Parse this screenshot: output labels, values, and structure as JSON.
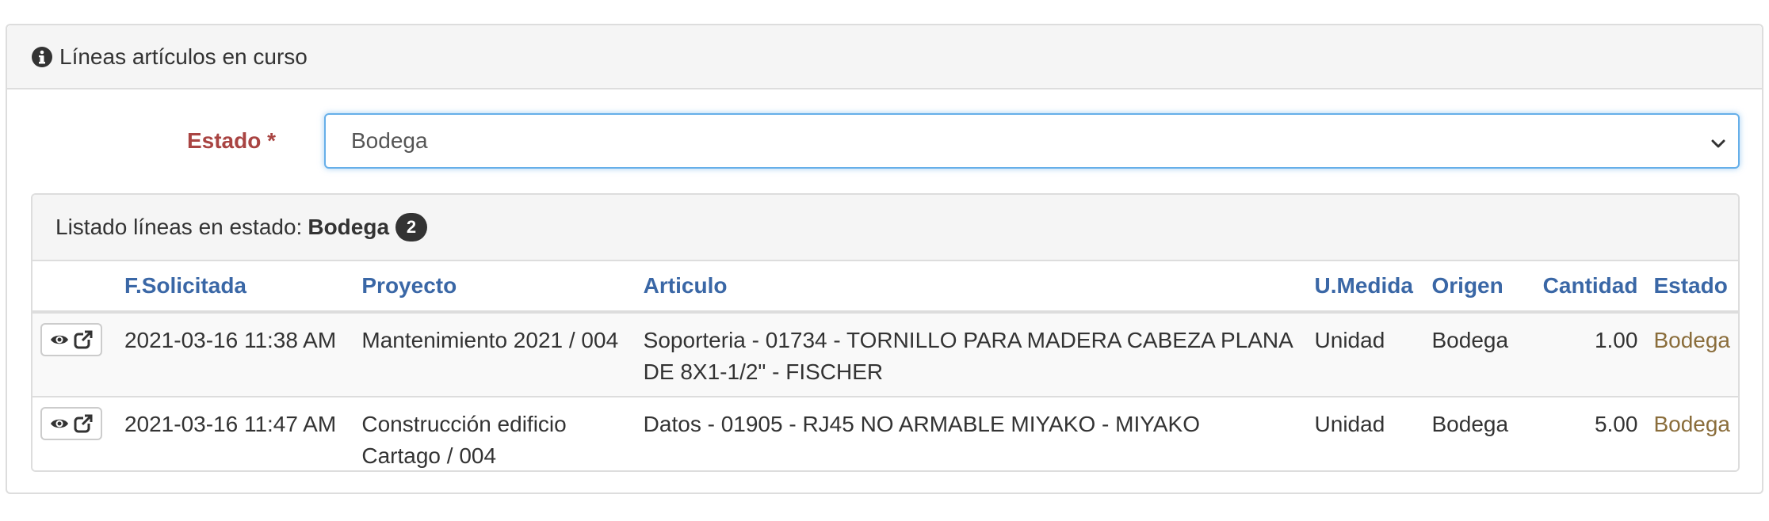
{
  "panel": {
    "title": "Líneas artículos en curso"
  },
  "form": {
    "label": "Estado *",
    "selected": "Bodega"
  },
  "listing": {
    "prefix": "Listado líneas en estado:",
    "state": "Bodega",
    "count": "2"
  },
  "table": {
    "columns": [
      "F.Solicitada",
      "Proyecto",
      "Articulo",
      "U.Medida",
      "Origen",
      "Cantidad",
      "Estado"
    ],
    "rows": [
      {
        "fecha": "2021-03-16 11:38 AM",
        "proyecto": "Mantenimiento 2021 / 004",
        "articulo": "Soporteria - 01734 - TORNILLO PARA MADERA CABEZA PLANA DE 8X1-1/2\" - FISCHER",
        "umedida": "Unidad",
        "origen": "Bodega",
        "cantidad": "1.00",
        "estado": "Bodega"
      },
      {
        "fecha": "2021-03-16 11:47 AM",
        "proyecto": "Construcción edificio Cartago / 004",
        "articulo": "Datos - 01905 - RJ45 NO ARMABLE MIYAKO - MIYAKO",
        "umedida": "Unidad",
        "origen": "Bodega",
        "cantidad": "5.00",
        "estado": "Bodega"
      }
    ]
  },
  "icons": {
    "heading": "info-circle-icon",
    "view": "eye-icon",
    "open": "external-link-icon",
    "select": "chevron-down-icon"
  },
  "colors": {
    "label": "#a94442",
    "header": "#3a67a6",
    "estado": "#8a6d3b",
    "focus": "#66afe9"
  }
}
